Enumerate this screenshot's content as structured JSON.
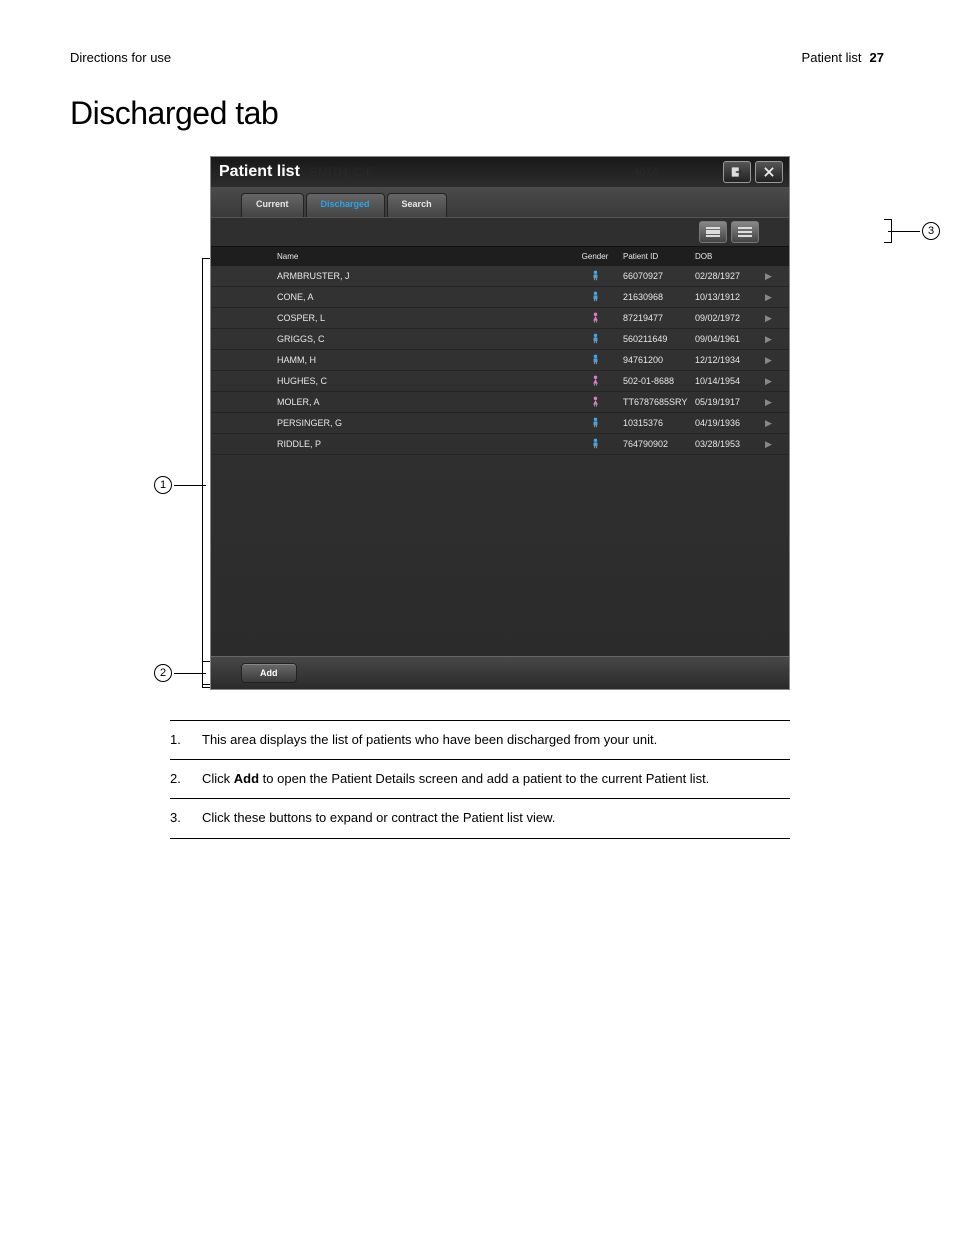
{
  "header": {
    "left": "Directions for use",
    "right_label": "Patient list",
    "page_number": "27"
  },
  "page_title": "Discharged tab",
  "app": {
    "title": "Patient list",
    "ghost_name": "SMITH, C F",
    "ghost_room": "407A",
    "tabs": {
      "current": "Current",
      "discharged": "Discharged",
      "search": "Search"
    },
    "columns": {
      "name": "Name",
      "gender": "Gender",
      "patient_id": "Patient ID",
      "dob": "DOB"
    },
    "rows": [
      {
        "name": "ARMBRUSTER, J",
        "gender": "M",
        "pid": "66070927",
        "dob": "02/28/1927"
      },
      {
        "name": "CONE, A",
        "gender": "M",
        "pid": "21630968",
        "dob": "10/13/1912"
      },
      {
        "name": "COSPER, L",
        "gender": "F",
        "pid": "87219477",
        "dob": "09/02/1972"
      },
      {
        "name": "GRIGGS, C",
        "gender": "M",
        "pid": "560211649",
        "dob": "09/04/1961"
      },
      {
        "name": "HAMM, H",
        "gender": "M",
        "pid": "94761200",
        "dob": "12/12/1934"
      },
      {
        "name": "HUGHES, C",
        "gender": "F",
        "pid": "502-01-8688",
        "dob": "10/14/1954"
      },
      {
        "name": "MOLER, A",
        "gender": "F",
        "pid": "TT6787685SRY",
        "dob": "05/19/1917"
      },
      {
        "name": "PERSINGER, G",
        "gender": "M",
        "pid": "10315376",
        "dob": "04/19/1936"
      },
      {
        "name": "RIDDLE, P",
        "gender": "M",
        "pid": "764790902",
        "dob": "03/28/1953"
      }
    ],
    "add_label": "Add"
  },
  "callouts": {
    "c1": "1",
    "c2": "2",
    "c3": "3"
  },
  "legend": [
    {
      "num": "1.",
      "text_pre": "This area displays the list of patients who have been discharged from your unit.",
      "bold": "",
      "text_post": ""
    },
    {
      "num": "2.",
      "text_pre": "Click ",
      "bold": "Add",
      "text_post": " to open the Patient Details screen and add a patient to the current Patient list."
    },
    {
      "num": "3.",
      "text_pre": "Click these buttons to expand or contract the Patient list view.",
      "bold": "",
      "text_post": ""
    }
  ]
}
